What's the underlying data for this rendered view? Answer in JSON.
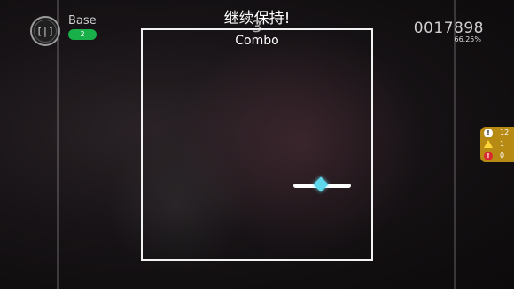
{
  "hud": {
    "pause_icon": "pause-icon",
    "pause_glyph": "[|]",
    "song_title": "Base",
    "level_badge": "2",
    "hint_text": "继续保持!",
    "combo_count": "3",
    "combo_label": "Combo",
    "score": "0017898",
    "accuracy": "66.25%"
  },
  "stats_panel": {
    "items": [
      {
        "icon": "info-icon",
        "glyph": "!",
        "value": "12"
      },
      {
        "icon": "warning-icon",
        "glyph": "",
        "value": "1"
      },
      {
        "icon": "error-icon",
        "glyph": "!",
        "value": "0"
      }
    ],
    "color": "#b78a13"
  },
  "colors": {
    "accent_green": "#19b04a",
    "note_cyan": "#5ed8ec"
  }
}
